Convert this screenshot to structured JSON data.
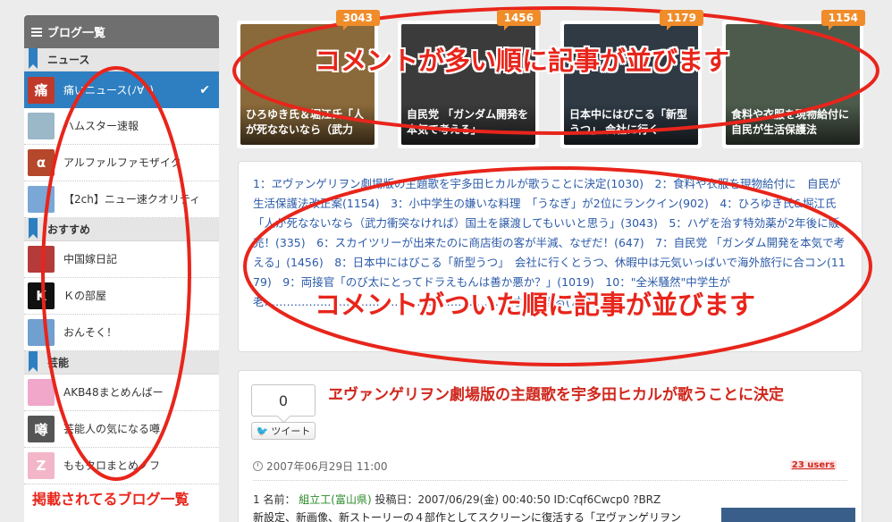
{
  "sidebar": {
    "header": "ブログ一覧",
    "categories": [
      {
        "label": "ニュース",
        "items": [
          {
            "label": "痛いニュース(ﾉ∀`)",
            "active": true,
            "thumb_text": "痛",
            "thumb_color": "#c0392b"
          },
          {
            "label": "ハムスター速報",
            "active": false,
            "thumb_text": "",
            "thumb_color": "#9ab8c8"
          },
          {
            "label": "アルファルファモザイク",
            "active": false,
            "thumb_text": "α",
            "thumb_color": "#b5472a"
          },
          {
            "label": "【2ch】ニュー速クオリティ",
            "active": false,
            "thumb_text": "",
            "thumb_color": "#7aa7d6"
          }
        ]
      },
      {
        "label": "おすすめ",
        "items": [
          {
            "label": "中国嫁日記",
            "active": false,
            "thumb_text": "",
            "thumb_color": "#b53a3a"
          },
          {
            "label": "Ｋの部屋",
            "active": false,
            "thumb_text": "K",
            "thumb_color": "#111111"
          },
          {
            "label": "おんそく！",
            "active": false,
            "thumb_text": "",
            "thumb_color": "#6fa0d0"
          }
        ]
      },
      {
        "label": "芸能",
        "items": [
          {
            "label": "AKB48まとめんばー",
            "active": false,
            "thumb_text": "",
            "thumb_color": "#f0a7c9"
          },
          {
            "label": "芸能人の気になる噂",
            "active": false,
            "thumb_text": "噂",
            "thumb_color": "#555555"
          },
          {
            "label": "ももクロまとめノフ",
            "active": false,
            "thumb_text": "Z",
            "thumb_color": "#f3b6c9"
          }
        ]
      }
    ]
  },
  "top_cards": [
    {
      "count": "3043",
      "caption": "ひろゆき氏＆堀江氏「人が死なないなら（武力",
      "bg": "#8a6a3a"
    },
    {
      "count": "1456",
      "caption": "自民党 「ガンダム開発を本気で考える」",
      "bg": "#3b3b3b"
    },
    {
      "count": "1179",
      "caption": "日本中にはびこる「新型うつ」 会社に行く",
      "bg": "#2f3a44"
    },
    {
      "count": "1154",
      "caption": "食料や衣服を現物給付に 自民が生活保護法",
      "bg": "#4d5b4c"
    }
  ],
  "ranking_text": "1：ヱヴァンゲリヲン劇場版の主題歌を宇多田ヒカルが歌うことに決定(1030)　2：食料や衣服を現物給付に　自民が生活保護法改正案(1154)　3：小中学生の嫌いな料理　「うなぎ」が2位にランクイン(902)　4：ひろゆき氏&堀江氏「人が死なないなら（武力衝突なければ）国土を譲渡してもいいと思う」(3043)　5：ハゲを治す特効薬が2年後に販売！(335)　6：スカイツリーが出来たのに商店街の客が半減、なぜだ！(647)　7：自民党 「ガンダム開発を本気で考える」(1456)　8：日本中にはびこる「新型うつ」　会社に行くとうつ、休暇中は元気いっぱいで海外旅行に合コン(1179)　9：両接官「のび太にとってドラえもんは善か悪か？」(1019)　10：\"全米騒然\"中学生が老…………………………………………………………付金集まる(772)",
  "article": {
    "tweet_count": "0",
    "tweet_label": "ツイート",
    "title": "ヱヴァンゲリヲン劇場版の主題歌を宇多田ヒカルが歌うことに決定",
    "date": "2007年06月29日 11:00",
    "users_badge": "23 users",
    "meta_prefix": "1 名前：",
    "meta_name": "組立工(富山県)",
    "meta_suffix": "投稿日：2007/06/29(金) 00:40:50 ID:Cqf6Cwcp0 ?BRZ",
    "body": "新設定、新画像、新ストーリーの４部作としてスクリーンに復活する「ヱヴァンゲリヲン"
  },
  "annotations": {
    "top": "コメントが多い順に記事が並びます",
    "middle": "コメントがついた順に記事が並びます",
    "sidebar": "掲載されてるブログ一覧"
  },
  "colors": {
    "accent_blue": "#2d7fc1",
    "badge_orange": "#f08c2a",
    "title_red": "#d0261c",
    "annotation_red": "#e8251b",
    "link_blue": "#2b5aa8"
  }
}
